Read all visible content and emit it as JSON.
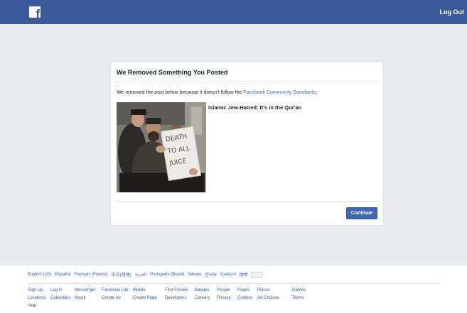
{
  "header": {
    "logo_letter": "f",
    "logout_label": "Log Out"
  },
  "dialog": {
    "title": "We Removed Something You Posted",
    "message": "We removed the post below because it doesn't follow the ",
    "standards_link": "Facebook Community Standards",
    "message_end": ":",
    "post_title": "Islamic Jew-Hatred: It's in the Qur'an",
    "sign_text": [
      "DEATH",
      "TO ALL",
      "JUICE"
    ],
    "continue_label": "Continue"
  },
  "footer": {
    "languages": [
      "English (US)",
      "Español",
      "Français (France)",
      "中文(简体)",
      "العربية",
      "Português (Brasil)",
      "Italiano",
      "한국어",
      "Deutsch",
      "हिन्दी"
    ],
    "more_label": "...",
    "links": [
      [
        "Sign Up",
        "Log In",
        "Messenger",
        "Facebook Lite",
        "Mobile",
        "Find Friends",
        "Badges",
        "People",
        "Pages",
        "Places",
        "Games"
      ],
      [
        "Locations",
        "Celebrities",
        "About",
        "Create Ad",
        "Create Page",
        "Developers",
        "Careers",
        "Privacy",
        "Cookies",
        "Ad Choices",
        "Terms"
      ],
      [
        "Help"
      ]
    ]
  }
}
